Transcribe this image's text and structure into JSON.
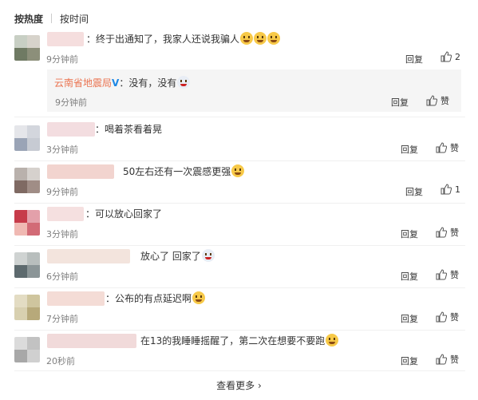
{
  "sort": {
    "hot": "按热度",
    "time": "按时间"
  },
  "comments": [
    {
      "text": "：终于出通知了，我家人还说我骗人",
      "emojis": 3,
      "time": "9分钟前",
      "reply": "回复",
      "likes": "2"
    },
    {
      "text": "：喝着茶看着晃",
      "time": "3分钟前",
      "reply": "回复",
      "likes": "赞"
    },
    {
      "text": "50左右还有一次震感更强",
      "time": "9分钟前",
      "reply": "回复",
      "likes": "1"
    },
    {
      "text": "：可以放心回家了",
      "time": "3分钟前",
      "reply": "回复",
      "likes": "赞"
    },
    {
      "text": "放心了 回家了",
      "time": "6分钟前",
      "reply": "回复",
      "likes": "赞"
    },
    {
      "text": "：公布的有点延迟啊",
      "time": "7分钟前",
      "reply": "回复",
      "likes": "赞"
    },
    {
      "text": "在13的我睡睡摇醒了，第二次在想要不要跑",
      "time": "20秒前",
      "reply": "回复",
      "likes": "赞"
    }
  ],
  "sub_reply": {
    "name": "云南省地震局",
    "text": "：没有，没有",
    "time": "9分钟前",
    "reply": "回复",
    "likes": "赞"
  },
  "more": "查看更多",
  "colors": {
    "official_name": "#eb7350",
    "vip": "#1e88e5"
  }
}
